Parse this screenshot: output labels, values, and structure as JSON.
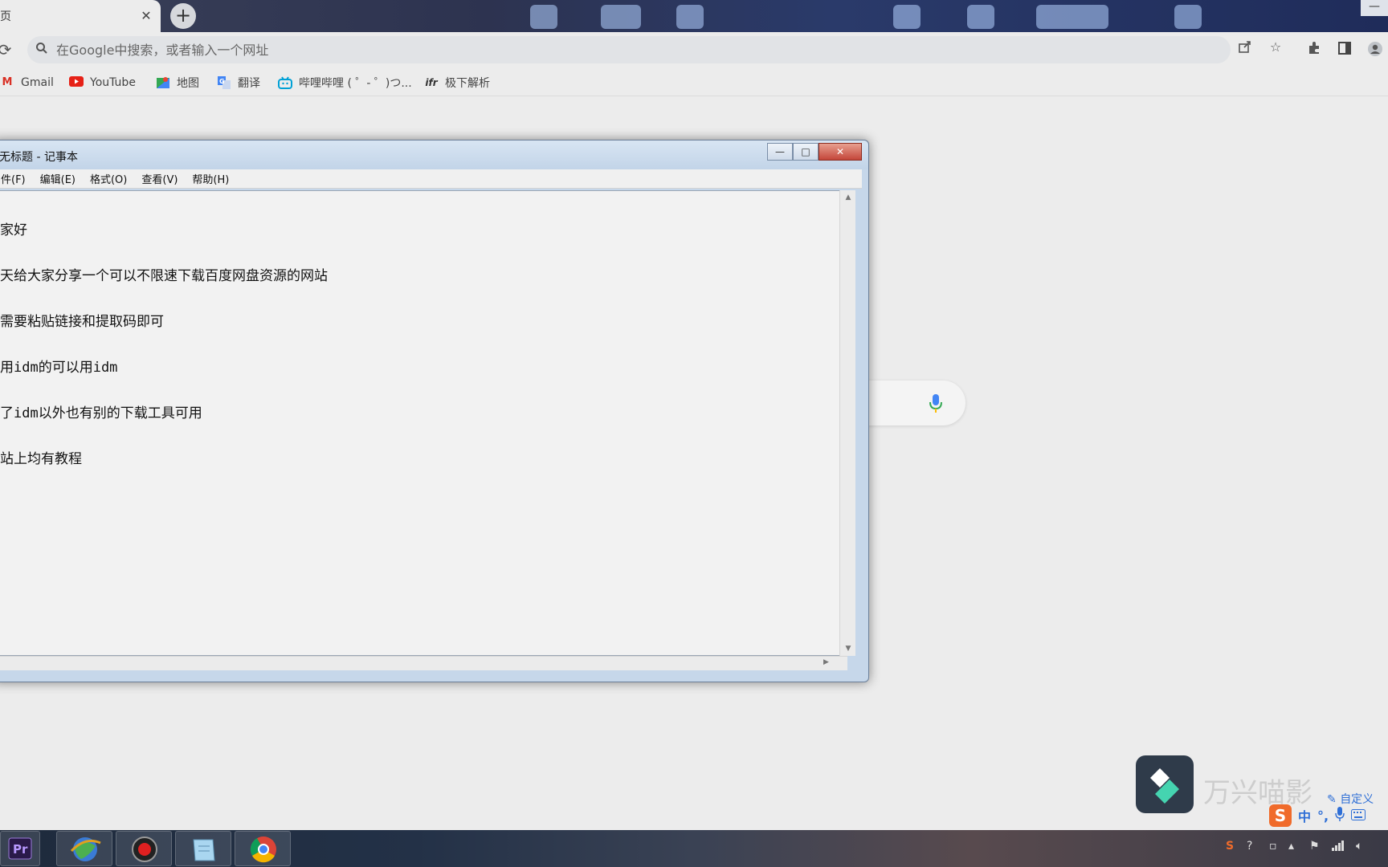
{
  "browser": {
    "tab": {
      "title": "页",
      "close": "✕"
    },
    "new_tab": "+",
    "omnibox": {
      "placeholder": "在Google中搜索，或者输入一个网址"
    },
    "bookmarks": [
      {
        "label": "Gmail",
        "icon": "gmail-icon",
        "color": "#d93025"
      },
      {
        "label": "YouTube",
        "icon": "youtube-icon",
        "color": "#e62117"
      },
      {
        "label": "地图",
        "icon": "maps-icon",
        "color": "#34a853"
      },
      {
        "label": "翻译",
        "icon": "translate-icon",
        "color": "#4285f4"
      },
      {
        "label": "哔哩哔哩 ( ゜- ゜)つ...",
        "icon": "bilibili-icon",
        "color": "#00a1d6"
      },
      {
        "label": "极下解析",
        "icon": "jixia-icon",
        "color": "#333333"
      }
    ]
  },
  "notepad": {
    "title": "无标题 - 记事本",
    "menu": [
      "件(F)",
      "编辑(E)",
      "格式(O)",
      "查看(V)",
      "帮助(H)"
    ],
    "lines": [
      "家好",
      "天给大家分享一个可以不限速下载百度网盘资源的网站",
      "需要粘贴链接和提取码即可",
      "用idm的可以用idm",
      "了idm以外也有别的下载工具可用",
      "站上均有教程"
    ]
  },
  "watermark": {
    "text": "万兴喵影"
  },
  "ime": {
    "custom_label": "自定义",
    "mode": "中",
    "punct": "°,",
    "colors": {
      "brand": "#f06b2b",
      "accent": "#2f6fd6"
    }
  },
  "taskbar": {
    "apps": [
      "premiere-pro-icon",
      "browser-globe-icon",
      "record-icon",
      "notepad-icon",
      "chrome-icon"
    ]
  }
}
